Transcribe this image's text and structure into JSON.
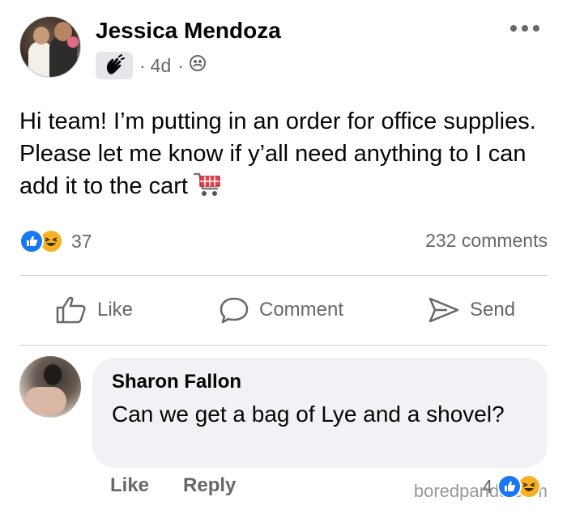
{
  "post": {
    "author": "Jessica Mendoza",
    "time": "4d",
    "body": "Hi team! I’m putting in an order for office supplies. Please let me know if y’all need anything to I can add it to the cart",
    "icons": {
      "badge": "waving-hand-icon",
      "audience": "group-icon",
      "menu": "more-options-icon",
      "emoji": "shopping-cart-icon"
    }
  },
  "stats": {
    "reaction_count": "37",
    "comments": "232 comments",
    "reactions": [
      "like",
      "haha"
    ]
  },
  "actions": {
    "like": "Like",
    "comment": "Comment",
    "send": "Send"
  },
  "comment": {
    "author": "Sharon Fallon",
    "text": "Can we get a bag of Lye and a shovel?",
    "like": "Like",
    "reply": "Reply",
    "reaction_count": "4"
  },
  "watermark": "boredpanda.com",
  "colors": {
    "like_blue": "#1877f2",
    "haha_yellow": "#f7b125",
    "secondary_text": "#65676b",
    "bubble_bg": "#f0f2f5"
  }
}
